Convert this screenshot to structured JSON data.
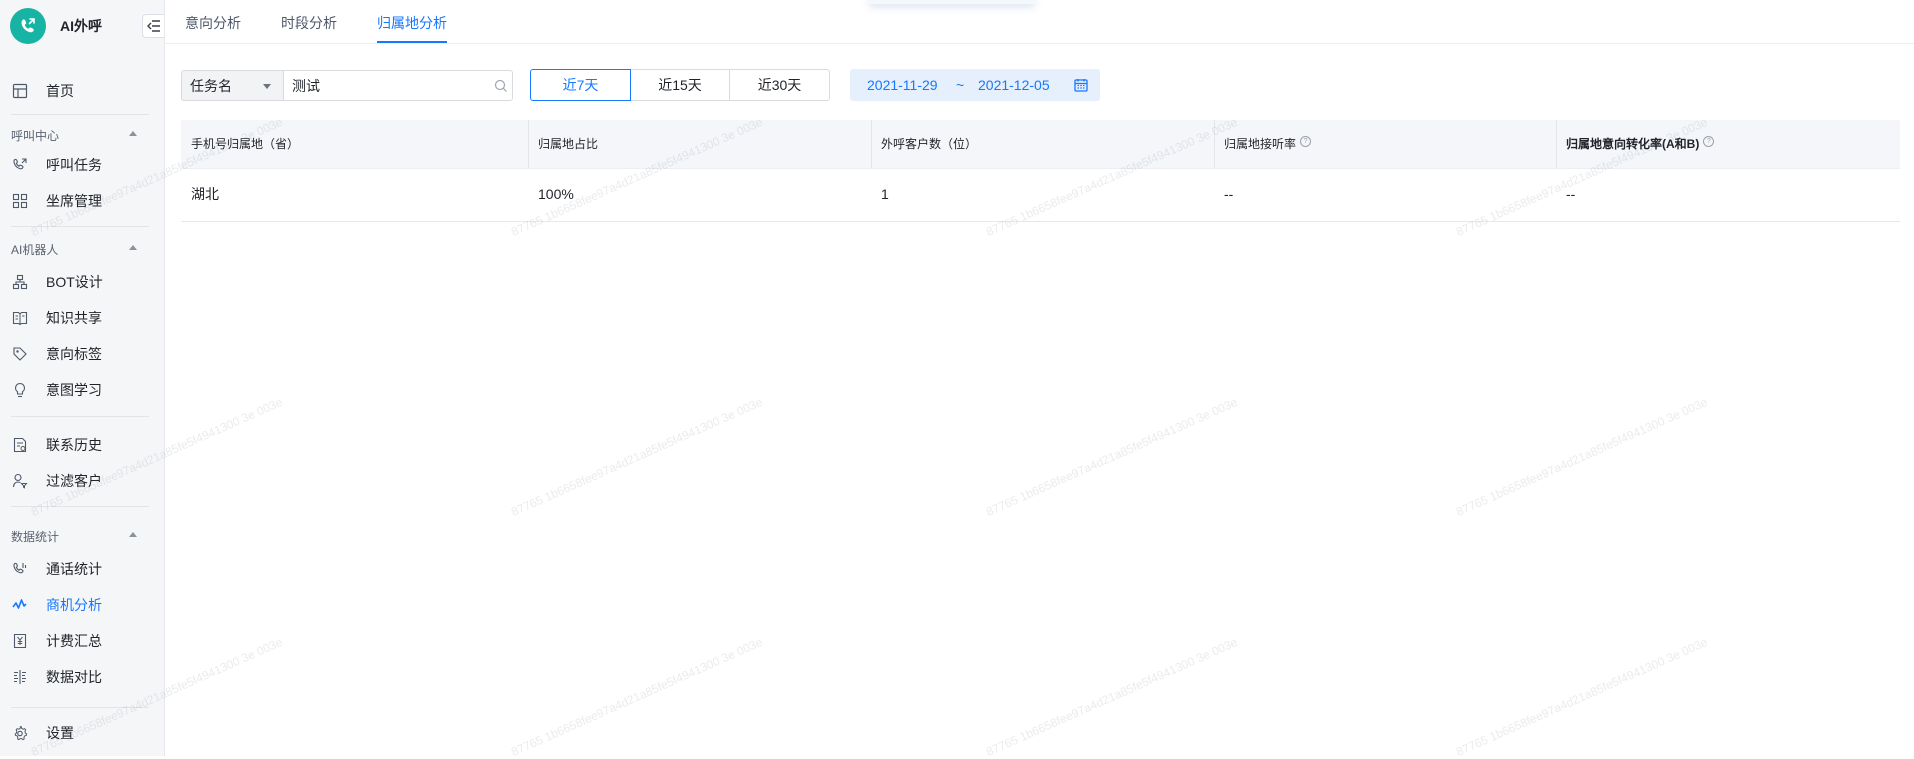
{
  "app": {
    "title": "AI外呼"
  },
  "nav": {
    "home": "首页",
    "groups": {
      "call_center": "呼叫中心",
      "ai_robot": "AI机器人",
      "data_stats": "数据统计"
    },
    "items": {
      "call_task": "呼叫任务",
      "seat_mgmt": "坐席管理",
      "bot_design": "BOT设计",
      "knowledge": "知识共享",
      "intent_tag": "意向标签",
      "intent_learn": "意图学习",
      "contact_history": "联系历史",
      "filter_customer": "过滤客户",
      "call_stats": "通话统计",
      "opportunity": "商机分析",
      "billing": "计费汇总",
      "data_compare": "数据对比",
      "settings": "设置"
    },
    "active": "商机分析"
  },
  "tabs": {
    "intent": "意向分析",
    "period": "时段分析",
    "region": "归属地分析",
    "active": "归属地分析"
  },
  "filter": {
    "field": "任务名",
    "search_value": "测试",
    "ranges": [
      "近7天",
      "近15天",
      "近30天"
    ],
    "active_range": "近7天",
    "date_start": "2021-11-29",
    "date_sep": "~",
    "date_end": "2021-12-05"
  },
  "table": {
    "headers": {
      "province": "手机号归属地（省）",
      "ratio": "归属地占比",
      "count": "外呼客户数（位）",
      "answer_rate": "归属地接听率",
      "conversion": "归属地意向转化率(A和B)"
    },
    "help_glyph": "?",
    "rows": [
      {
        "province": "湖北",
        "ratio": "100%",
        "count": "1",
        "answer_rate": "--",
        "conversion": "--"
      }
    ]
  },
  "watermark": "87765 1b6658fee97a4d21a85fe5f4941300 3e 003e",
  "colors": {
    "primary": "#1677ff",
    "brand": "#17b3a3",
    "sidebar_bg": "#f5f6f8",
    "header_bg": "#f4f6f9",
    "date_bg": "#e6f0fd"
  }
}
